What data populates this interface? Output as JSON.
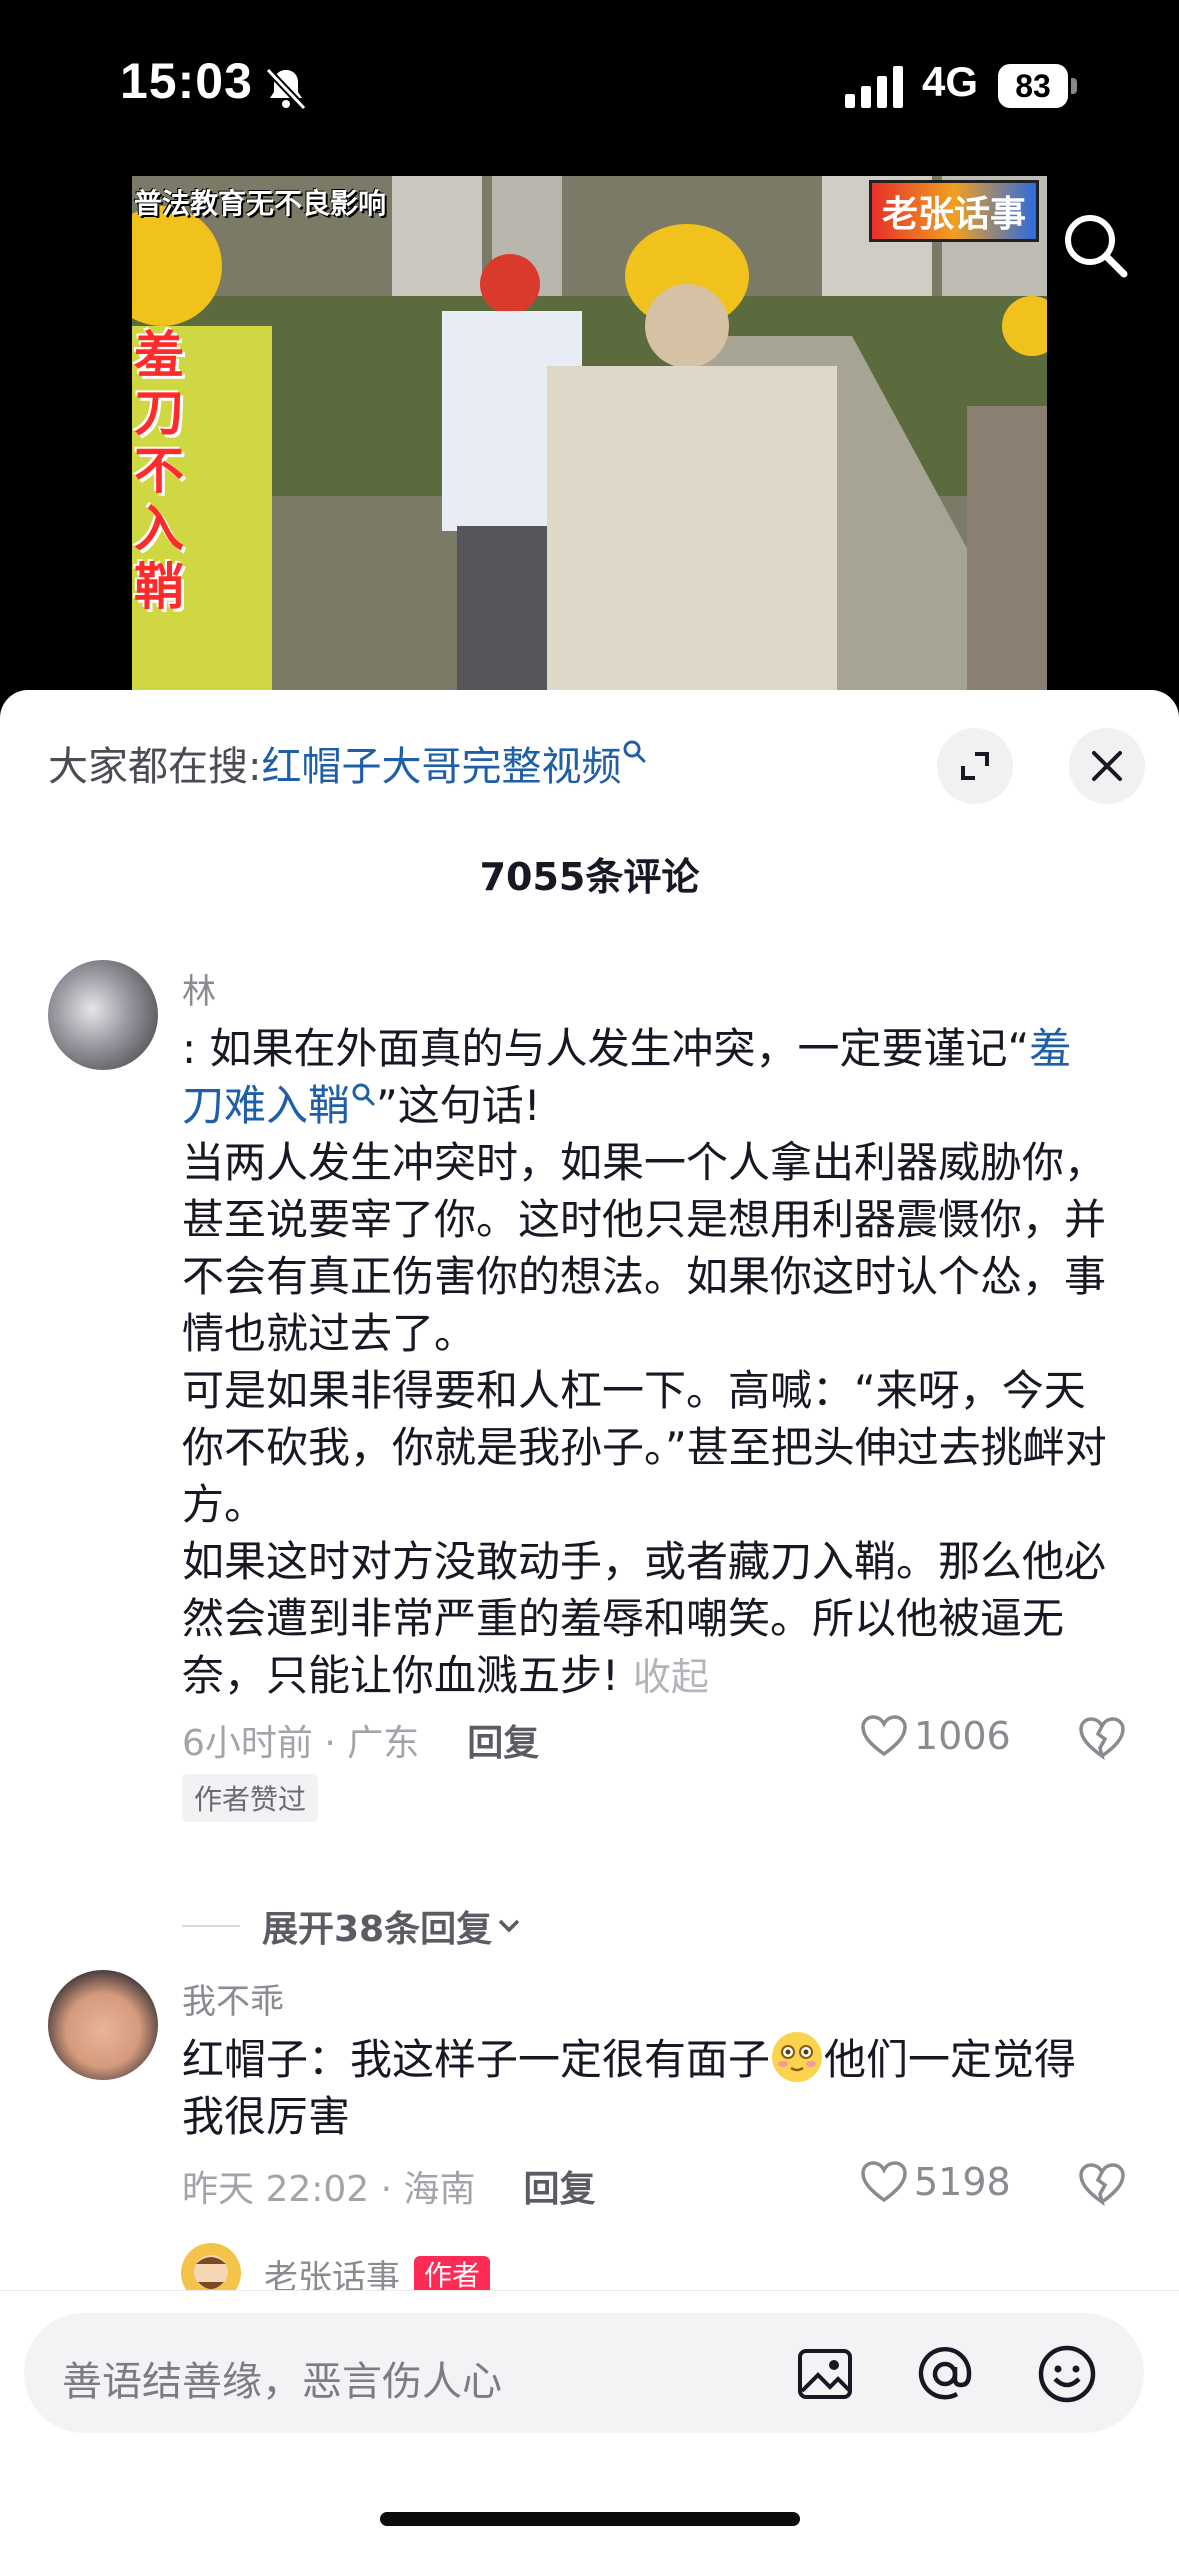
{
  "status_bar": {
    "time": "15:03",
    "network": "4G",
    "battery": "83"
  },
  "video": {
    "top_caption": "普法教育无不良影响",
    "logo_text": "老张话事",
    "side_caption": "羞刀不入鞘"
  },
  "sheet": {
    "hot_search_prefix": "大家都在搜:",
    "hot_search_term": "红帽子大哥完整视频",
    "comment_count": "7055条评论"
  },
  "comments": [
    {
      "user": "林",
      "text_1": ": 如果在外面真的与人发生冲突，一定要谨记“",
      "keyword": "羞刀难入鞘",
      "text_2": "”这句话!",
      "text_3": "当两人发生冲突时，如果一个人拿出利器威胁你，甚至说要宰了你。这时他只是想用利器震慑你，并不会有真正伤害你的想法。如果你这时认个怂，事情也就过去了。",
      "text_4": "可是如果非得要和人杠一下。高喊：“来呀，今天你不砍我，你就是我孙子。”甚至把头伸过去挑衅对方。",
      "text_5": "如果这时对方没敢动手，或者藏刀入鞘。那么他必然会遭到非常严重的羞辱和嘲笑。所以他被逼无奈，只能让你血溅五步!",
      "fold": "收起",
      "time_loc": "6小时前 · 广东",
      "reply": "回复",
      "likes": "1006",
      "badge": "作者赞过",
      "expand": "展开38条回复"
    },
    {
      "user": "我不乖",
      "text_1": "红帽子：我这样子一定很有面子",
      "text_2": "他们一定觉得我很厉害",
      "time_loc": "昨天 22:02 · 海南",
      "reply": "回复",
      "likes": "5198"
    },
    {
      "user": "老张话事",
      "badge": "作者"
    }
  ],
  "input": {
    "placeholder": "善语结善缘，恶言伤人心"
  },
  "colors": {
    "link": "#1f5fa8",
    "author_badge": "#fe2c55",
    "meta": "#a3a4a9"
  }
}
